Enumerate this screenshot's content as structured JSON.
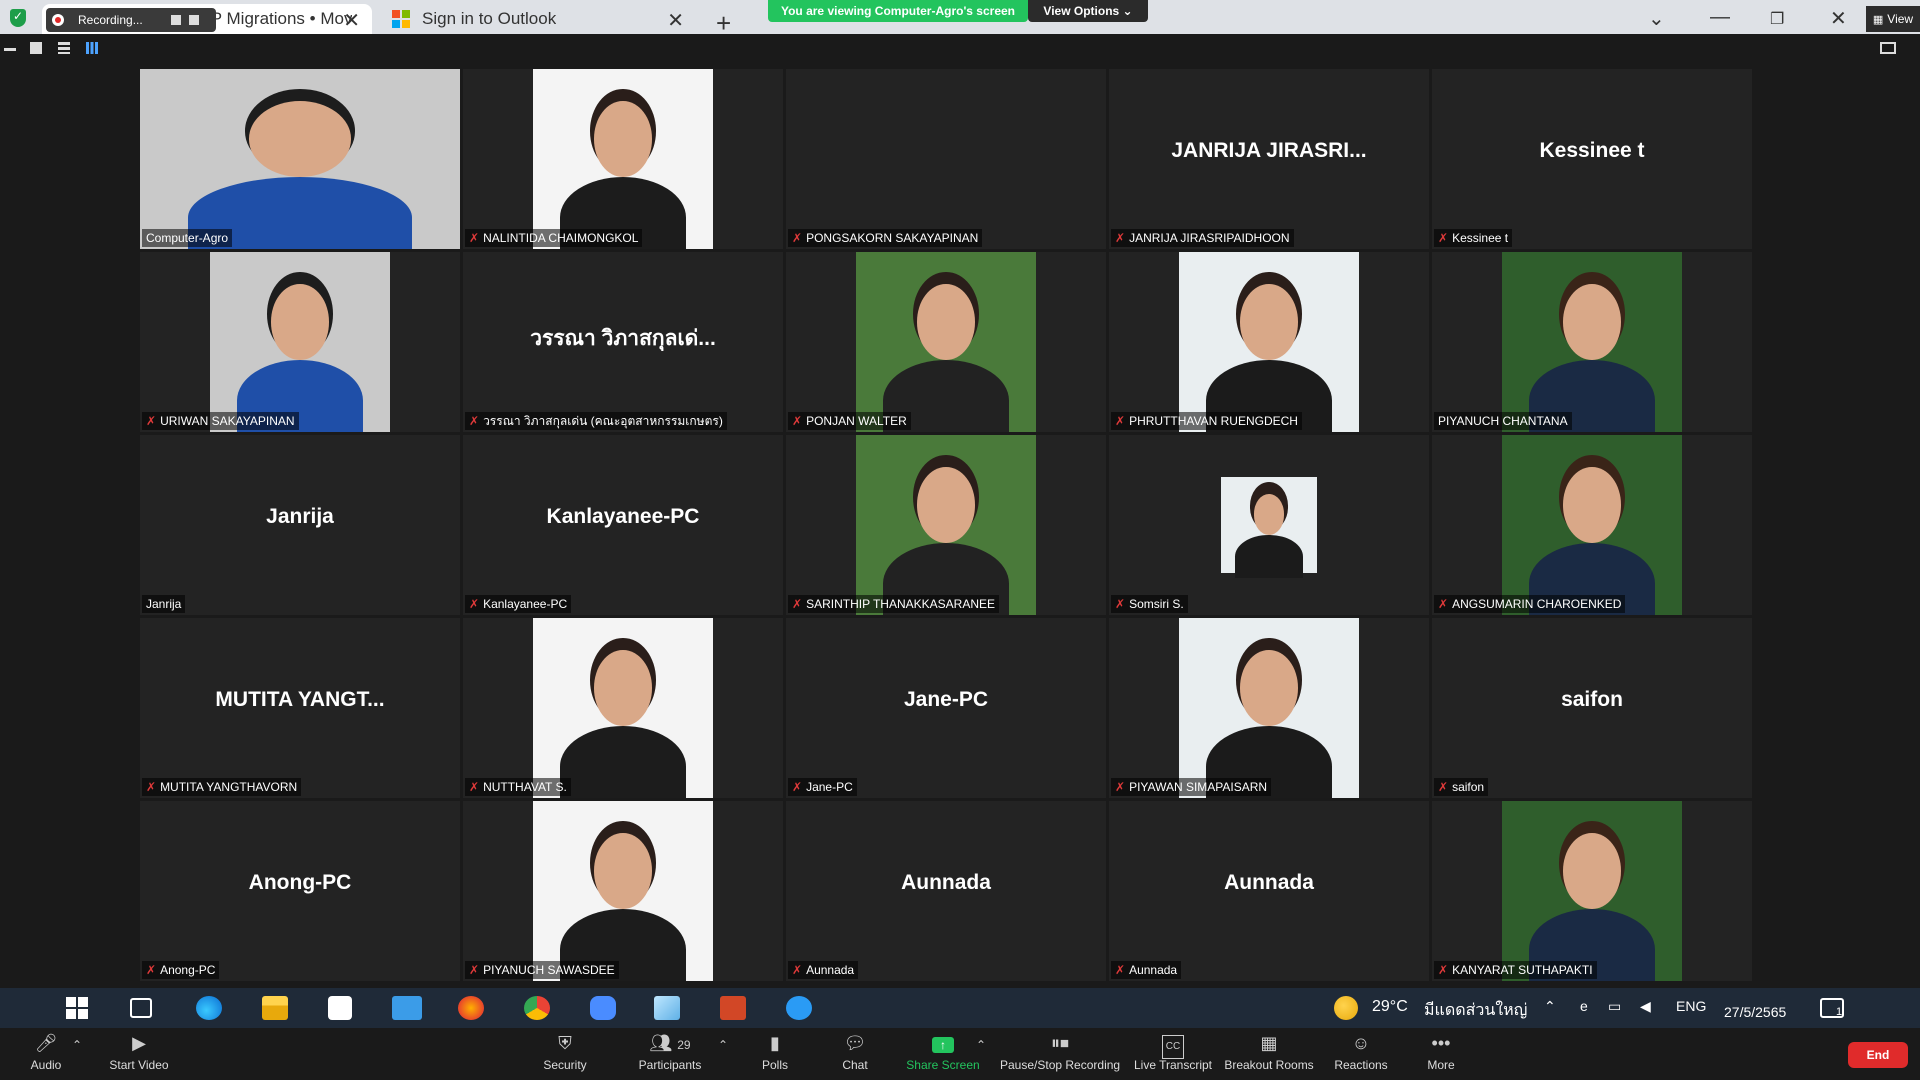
{
  "browser": {
    "recording_label": "Recording...",
    "tabs": [
      {
        "title": "Cloud ERP Migrations • Mov",
        "close": "✕"
      },
      {
        "title": "Sign in to Outlook",
        "close": "✕"
      }
    ],
    "new_tab": "+",
    "banner": "You are viewing Computer-Agro's screen",
    "view_options": "View Options ⌄",
    "view_button": "View"
  },
  "gallery": [
    [
      {
        "name": "Computer-Agro",
        "label": "Computer-Agro",
        "muted": false,
        "video": true,
        "speaking": true
      },
      {
        "name": "NALINTIDA CHAIMONGKOL",
        "label": "NALINTIDA CHAIMONGKOL",
        "muted": true,
        "video": true
      },
      {
        "name": "",
        "label": "PONGSAKORN SAKAYAPINAN",
        "muted": true,
        "video": false
      },
      {
        "name": "JANRIJA  JIRASRI...",
        "label": "JANRIJA JIRASRIPAIDHOON",
        "muted": true,
        "video": false
      },
      {
        "name": "Kessinee t",
        "label": "Kessinee t",
        "muted": true,
        "video": false
      }
    ],
    [
      {
        "name": "URIWAN SAKAYAPINAN",
        "label": "URIWAN SAKAYAPINAN",
        "muted": true,
        "video": true
      },
      {
        "name": "วรรณา วิภาสกุลเด่...",
        "label": "วรรณา วิภาสกุลเด่น (คณะอุตสาหกรรมเกษตร)",
        "muted": true,
        "video": false
      },
      {
        "name": "PONJAN WALTER",
        "label": "PONJAN WALTER",
        "muted": true,
        "video": true
      },
      {
        "name": "PHRUTTHAVAN RUENGDECH",
        "label": "PHRUTTHAVAN RUENGDECH",
        "muted": true,
        "video": true
      },
      {
        "name": "PIYANUCH CHANTANA",
        "label": "PIYANUCH CHANTANA",
        "muted": false,
        "video": true
      }
    ],
    [
      {
        "name": "Janrija",
        "label": "Janrija",
        "muted": false,
        "video": false
      },
      {
        "name": "Kanlayanee-PC",
        "label": "Kanlayanee-PC",
        "muted": true,
        "video": false
      },
      {
        "name": "SARINTHIP THANAKKASARANEE",
        "label": "SARINTHIP THANAKKASARANEE",
        "muted": true,
        "video": true
      },
      {
        "name": "Somsiri S.",
        "label": "Somsiri S.",
        "muted": true,
        "video": true,
        "small": true
      },
      {
        "name": "ANGSUMARIN CHAROENKED",
        "label": "ANGSUMARIN CHAROENKED",
        "muted": true,
        "video": true
      }
    ],
    [
      {
        "name": "MUTITA  YANGT...",
        "label": "MUTITA YANGTHAVORN",
        "muted": true,
        "video": false
      },
      {
        "name": "NUTTHAVAT S.",
        "label": "NUTTHAVAT S.",
        "muted": true,
        "video": true
      },
      {
        "name": "Jane-PC",
        "label": "Jane-PC",
        "muted": true,
        "video": false
      },
      {
        "name": "PIYAWAN SIMAPAISARN",
        "label": "PIYAWAN SIMAPAISARN",
        "muted": true,
        "video": true
      },
      {
        "name": "saifon",
        "label": "saifon",
        "muted": true,
        "video": false
      }
    ],
    [
      {
        "name": "Anong-PC",
        "label": "Anong-PC",
        "muted": true,
        "video": false
      },
      {
        "name": "PIYANUCH SAWASDEE",
        "label": "PIYANUCH SAWASDEE",
        "muted": true,
        "video": true
      },
      {
        "name": "Aunnada",
        "label": "Aunnada",
        "muted": true,
        "video": false
      },
      {
        "name": "Aunnada",
        "label": "Aunnada",
        "muted": true,
        "video": false
      },
      {
        "name": "KANYARAT SUTHAPAKTI",
        "label": "KANYARAT SUTHAPAKTI",
        "muted": true,
        "video": true
      }
    ]
  ],
  "taskbar": {
    "weather_temp": "29°C",
    "weather_text": "มีแดดส่วนใหญ่",
    "language": "ENG",
    "date": "27/5/2565",
    "notifications": "1"
  },
  "controls": {
    "audio": "Audio",
    "start_video": "Start Video",
    "security": "Security",
    "participants": "Participants",
    "participants_count": "29",
    "polls": "Polls",
    "chat": "Chat",
    "share_screen": "Share Screen",
    "pause_stop_recording": "Pause/Stop Recording",
    "live_transcript": "Live Transcript",
    "breakout_rooms": "Breakout Rooms",
    "reactions": "Reactions",
    "more": "More",
    "end": "End"
  },
  "colors": {
    "accent_green": "#23c45e",
    "end_red": "#e02b2b",
    "mute_red": "#e03a3a",
    "speaking_outline": "#b8e986"
  }
}
